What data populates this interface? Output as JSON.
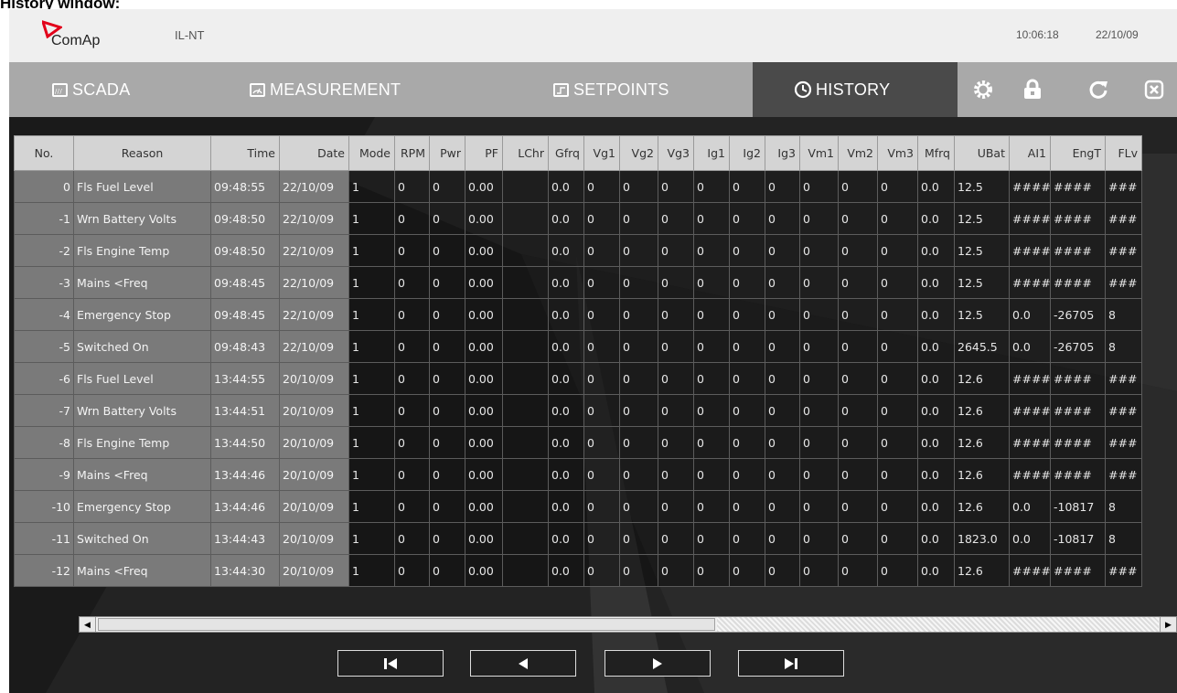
{
  "caption": "History window:",
  "header": {
    "brand": "ComAp",
    "device": "IL-NT",
    "time": "10:06:18",
    "date": "22/10/09"
  },
  "tabs": [
    {
      "label": "SCADA",
      "icon": "scada-icon"
    },
    {
      "label": "MEASUREMENT",
      "icon": "measurement-icon"
    },
    {
      "label": "SETPOINTS",
      "icon": "setpoints-icon"
    },
    {
      "label": "HISTORY",
      "icon": "history-icon",
      "active": true
    }
  ],
  "toolbar_icons": [
    "settings-gear-icon",
    "lock-icon",
    "refresh-icon",
    "close-icon"
  ],
  "table": {
    "columns": [
      "No.",
      "Reason",
      "Time",
      "Date",
      "Mode",
      "RPM",
      "Pwr",
      "PF",
      "LChr",
      "Gfrq",
      "Vg1",
      "Vg2",
      "Vg3",
      "Ig1",
      "Ig2",
      "Ig3",
      "Vm1",
      "Vm2",
      "Vm3",
      "Mfrq",
      "UBat",
      "AI1",
      "EngT",
      "FLv"
    ],
    "rows": [
      [
        "0",
        "Fls Fuel Level",
        "09:48:55",
        "22/10/09",
        "1",
        "0",
        "0",
        "0.00",
        "",
        "0.0",
        "0",
        "0",
        "0",
        "0",
        "0",
        "0",
        "0",
        "0",
        "0",
        "0.0",
        "12.5",
        "####",
        "####",
        "###"
      ],
      [
        "-1",
        "Wrn Battery Volts",
        "09:48:50",
        "22/10/09",
        "1",
        "0",
        "0",
        "0.00",
        "",
        "0.0",
        "0",
        "0",
        "0",
        "0",
        "0",
        "0",
        "0",
        "0",
        "0",
        "0.0",
        "12.5",
        "####",
        "####",
        "###"
      ],
      [
        "-2",
        "Fls Engine Temp",
        "09:48:50",
        "22/10/09",
        "1",
        "0",
        "0",
        "0.00",
        "",
        "0.0",
        "0",
        "0",
        "0",
        "0",
        "0",
        "0",
        "0",
        "0",
        "0",
        "0.0",
        "12.5",
        "####",
        "####",
        "###"
      ],
      [
        "-3",
        "Mains <Freq",
        "09:48:45",
        "22/10/09",
        "1",
        "0",
        "0",
        "0.00",
        "",
        "0.0",
        "0",
        "0",
        "0",
        "0",
        "0",
        "0",
        "0",
        "0",
        "0",
        "0.0",
        "12.5",
        "####",
        "####",
        "###"
      ],
      [
        "-4",
        "Emergency Stop",
        "09:48:45",
        "22/10/09",
        "1",
        "0",
        "0",
        "0.00",
        "",
        "0.0",
        "0",
        "0",
        "0",
        "0",
        "0",
        "0",
        "0",
        "0",
        "0",
        "0.0",
        "12.5",
        "0.0",
        "-26705",
        "8"
      ],
      [
        "-5",
        "Switched On",
        "09:48:43",
        "22/10/09",
        "1",
        "0",
        "0",
        "0.00",
        "",
        "0.0",
        "0",
        "0",
        "0",
        "0",
        "0",
        "0",
        "0",
        "0",
        "0",
        "0.0",
        "2645.5",
        "0.0",
        "-26705",
        "8"
      ],
      [
        "-6",
        "Fls Fuel Level",
        "13:44:55",
        "20/10/09",
        "1",
        "0",
        "0",
        "0.00",
        "",
        "0.0",
        "0",
        "0",
        "0",
        "0",
        "0",
        "0",
        "0",
        "0",
        "0",
        "0.0",
        "12.6",
        "####",
        "####",
        "###"
      ],
      [
        "-7",
        "Wrn Battery Volts",
        "13:44:51",
        "20/10/09",
        "1",
        "0",
        "0",
        "0.00",
        "",
        "0.0",
        "0",
        "0",
        "0",
        "0",
        "0",
        "0",
        "0",
        "0",
        "0",
        "0.0",
        "12.6",
        "####",
        "####",
        "###"
      ],
      [
        "-8",
        "Fls Engine Temp",
        "13:44:50",
        "20/10/09",
        "1",
        "0",
        "0",
        "0.00",
        "",
        "0.0",
        "0",
        "0",
        "0",
        "0",
        "0",
        "0",
        "0",
        "0",
        "0",
        "0.0",
        "12.6",
        "####",
        "####",
        "###"
      ],
      [
        "-9",
        "Mains <Freq",
        "13:44:46",
        "20/10/09",
        "1",
        "0",
        "0",
        "0.00",
        "",
        "0.0",
        "0",
        "0",
        "0",
        "0",
        "0",
        "0",
        "0",
        "0",
        "0",
        "0.0",
        "12.6",
        "####",
        "####",
        "###"
      ],
      [
        "-10",
        "Emergency Stop",
        "13:44:46",
        "20/10/09",
        "1",
        "0",
        "0",
        "0.00",
        "",
        "0.0",
        "0",
        "0",
        "0",
        "0",
        "0",
        "0",
        "0",
        "0",
        "0",
        "0.0",
        "12.6",
        "0.0",
        "-10817",
        "8"
      ],
      [
        "-11",
        "Switched On",
        "13:44:43",
        "20/10/09",
        "1",
        "0",
        "0",
        "0.00",
        "",
        "0.0",
        "0",
        "0",
        "0",
        "0",
        "0",
        "0",
        "0",
        "0",
        "0",
        "0.0",
        "1823.0",
        "0.0",
        "-10817",
        "8"
      ],
      [
        "-12",
        "Mains <Freq",
        "13:44:30",
        "20/10/09",
        "1",
        "0",
        "0",
        "0.00",
        "",
        "0.0",
        "0",
        "0",
        "0",
        "0",
        "0",
        "0",
        "0",
        "0",
        "0",
        "0.0",
        "12.6",
        "####",
        "####",
        "###"
      ]
    ]
  },
  "navigation": [
    {
      "name": "first-record",
      "icon": "skip-first-icon"
    },
    {
      "name": "previous-record",
      "icon": "previous-icon"
    },
    {
      "name": "next-record",
      "icon": "next-icon"
    },
    {
      "name": "last-record",
      "icon": "skip-last-icon"
    }
  ],
  "colors": {
    "tab_bar": "#a9a9a9",
    "active_tab": "#4a4a4a",
    "logo_red": "#e2001a",
    "content_bg": "#232323",
    "grey_cells": "#7a7a7a"
  }
}
